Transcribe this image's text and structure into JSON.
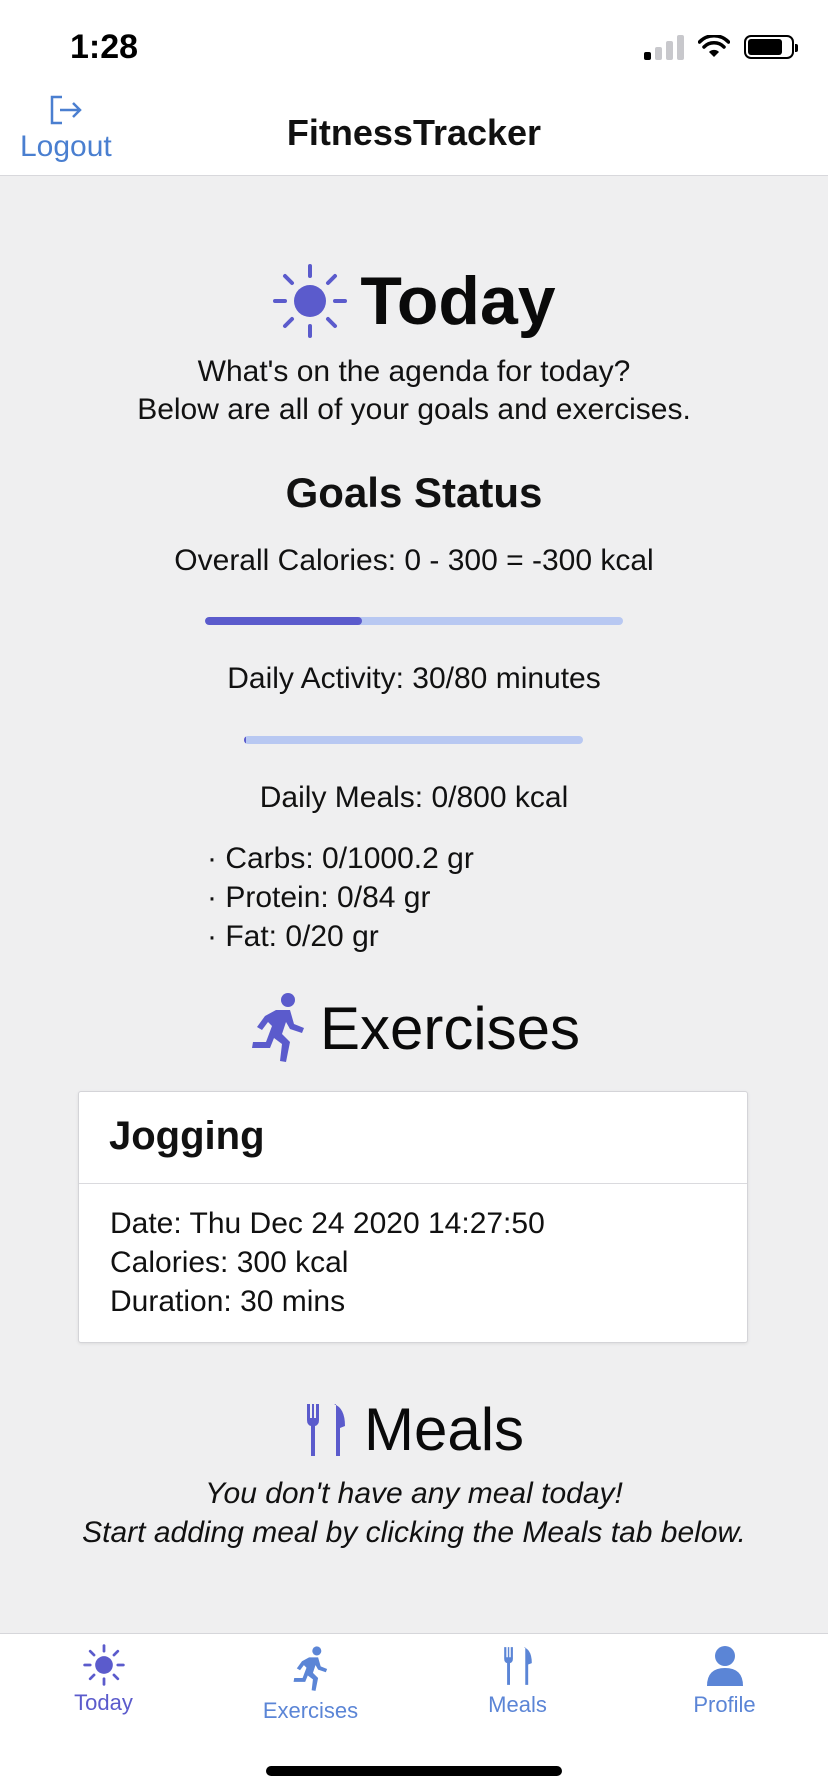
{
  "status_bar": {
    "time": "1:28"
  },
  "nav": {
    "logout_label": "Logout",
    "title": "FitnessTracker"
  },
  "today": {
    "title": "Today",
    "subtitle_line1": "What's on the agenda for today?",
    "subtitle_line2": "Below are all of your goals and exercises."
  },
  "goals": {
    "title": "Goals Status",
    "overall_calories": "Overall Calories: 0 - 300 = -300 kcal",
    "calories_progress": 0.375,
    "daily_activity": "Daily Activity: 30/80 minutes",
    "activity_progress": 0.005,
    "daily_meals": "Daily Meals: 0/800 kcal",
    "carbs": "· Carbs: 0/1000.2 gr",
    "protein": "· Protein: 0/84 gr",
    "fat": "· Fat: 0/20 gr"
  },
  "exercises": {
    "title": "Exercises",
    "items": [
      {
        "name": "Jogging",
        "date": "Date: Thu Dec 24 2020 14:27:50",
        "calories": "Calories: 300 kcal",
        "duration": "Duration: 30 mins"
      }
    ]
  },
  "meals": {
    "title": "Meals",
    "empty_line1": "You don't have any meal today!",
    "empty_line2": "Start adding meal by clicking the Meals tab below."
  },
  "tabs": [
    {
      "label": "Today",
      "icon": "sun-icon",
      "active": true
    },
    {
      "label": "Exercises",
      "icon": "runner-icon",
      "active": false
    },
    {
      "label": "Meals",
      "icon": "utensils-icon",
      "active": false
    },
    {
      "label": "Profile",
      "icon": "person-icon",
      "active": false
    }
  ],
  "colors": {
    "accent": "#5b5bcc",
    "tab_inactive": "#5b85d6",
    "bar_track": "#b8c8f2"
  }
}
